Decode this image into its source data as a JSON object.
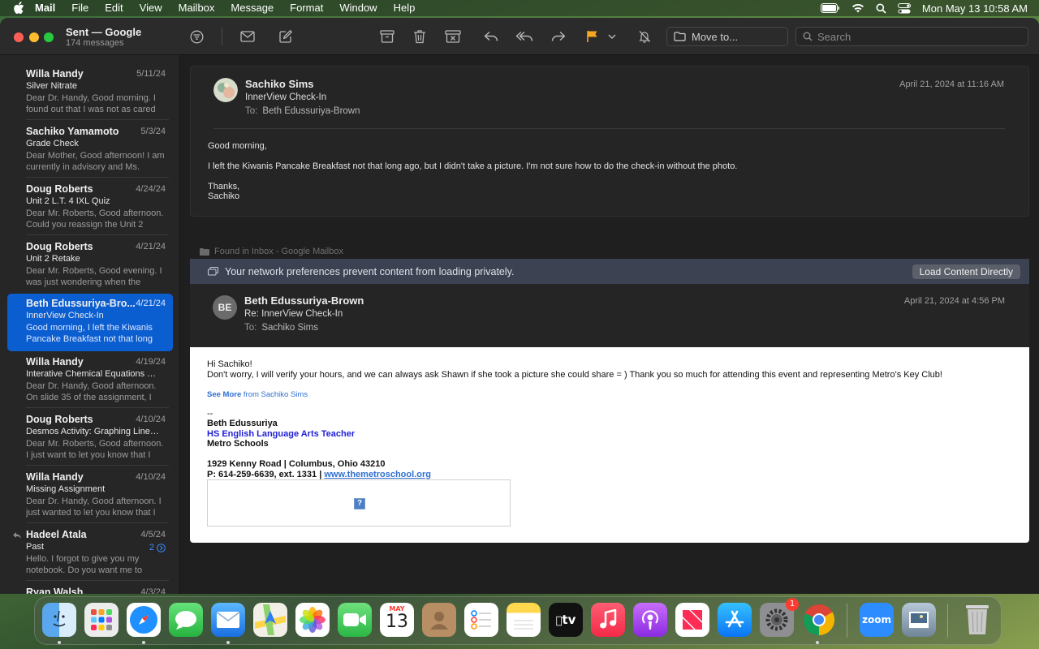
{
  "menubar": {
    "app_name": "Mail",
    "items": [
      "File",
      "Edit",
      "View",
      "Mailbox",
      "Message",
      "Format",
      "Window",
      "Help"
    ],
    "clock": "Mon May 13  10:58 AM",
    "icons": [
      "battery-icon",
      "wifi-icon",
      "spotlight-search-icon",
      "control-center-icon"
    ]
  },
  "toolbar": {
    "mailbox_title": "Sent — Google",
    "message_count": "174 messages",
    "move_to_label": "Move to...",
    "search_placeholder": "Search",
    "flag_color": "#f4a623",
    "buttons": [
      "filter",
      "get-mail",
      "compose",
      "archive",
      "delete",
      "junk",
      "reply",
      "reply-all",
      "forward",
      "flag",
      "flag-menu",
      "mute"
    ]
  },
  "messages": [
    {
      "sender": "Willa Handy",
      "date": "5/11/24",
      "subject": "Silver Nitrate",
      "preview": "Dear Dr. Handy, Good morning. I found out that I was not as cared a..."
    },
    {
      "sender": "Sachiko Yamamoto",
      "date": "5/3/24",
      "subject": "Grade Check",
      "preview": "Dear Mother, Good afternoon! I am currently in advisory and Ms. Bank..."
    },
    {
      "sender": "Doug Roberts",
      "date": "4/24/24",
      "subject": "Unit 2 L.T. 4 IXL Quiz",
      "preview": "Dear Mr. Roberts, Good afternoon. Could you reassign the Unit 2 L.T...."
    },
    {
      "sender": "Doug Roberts",
      "date": "4/21/24",
      "subject": "Unit 2 Retake",
      "preview": "Dear Mr. Roberts, Good evening. I was just wondering when the Unit..."
    },
    {
      "sender": "Beth Edussuriya-Bro...",
      "date": "4/21/24",
      "subject": "InnerView Check-In",
      "preview": "Good morning, I left the Kiwanis Pancake Breakfast not that long ag...",
      "selected": true
    },
    {
      "sender": "Willa Handy",
      "date": "4/19/24",
      "subject": "Interative Chemical Equations   Ty...",
      "preview": "Dear Dr. Handy, Good afternoon. On slide 35 of the assignment, I was c..."
    },
    {
      "sender": "Doug Roberts",
      "date": "4/10/24",
      "subject": "Desmos Activity: Graphing Linear...",
      "preview": "Dear Mr. Roberts, Good afternoon. I just want to let you know that I fini..."
    },
    {
      "sender": "Willa Handy",
      "date": "4/10/24",
      "subject": "Missing Assignment",
      "preview": "Dear Dr. Handy, Good afternoon. I just wanted to let you know that I j..."
    },
    {
      "sender": "Hadeel Atala",
      "date": "4/5/24",
      "subject": "Past",
      "preview": "Hello. I forgot to give you my notebook. Do you want me to take...",
      "thread_count": "2",
      "replied": true
    },
    {
      "sender": "Ryan Walsh",
      "date": "4/3/24",
      "subject": "",
      "preview": ""
    }
  ],
  "message1": {
    "from": "Sachiko Sims",
    "subject": "InnerView Check-In",
    "to_label": "To:",
    "to": "Beth Edussuriya-Brown",
    "date": "April 21, 2024 at 11:16 AM",
    "body": [
      "Good morning,",
      "I left the Kiwanis Pancake Breakfast not that long ago, but I didn't take a picture. I'm not sure how to do the check-in without the photo.",
      "Thanks,",
      "Sachiko"
    ]
  },
  "found_in": "Found in Inbox - Google Mailbox",
  "privacy_notice": {
    "text": "Your network preferences prevent content from loading privately.",
    "button": "Load Content Directly"
  },
  "message2": {
    "avatar_initials": "BE",
    "from": "Beth Edussuriya-Brown",
    "subject": "Re: InnerView Check-In",
    "to_label": "To:",
    "to": "Sachiko Sims",
    "date": "April 21, 2024 at 4:56 PM",
    "body": [
      "Hi Sachiko!",
      "Don't worry, I will verify your hours, and we can always ask Shawn if she took a picture she could share = ) Thank you so much for attending this event and representing Metro's Key Club!"
    ],
    "see_more": "See More",
    "see_more_from": "from Sachiko Sims",
    "signature": {
      "dash": "--",
      "name": "Beth Edussuriya",
      "title": "HS English Language Arts Teacher",
      "org": "Metro Schools",
      "address": "1929 Kenny Road | Columbus, Ohio 43210",
      "phone": "P: 614-259-6639, ext. 1331 | ",
      "website": "www.themetroschool.org"
    },
    "image_placeholder": "?"
  },
  "dock": {
    "apps": [
      "Finder",
      "Launchpad",
      "Safari",
      "Messages",
      "Mail",
      "Maps",
      "Photos",
      "FaceTime",
      "Calendar",
      "Contacts",
      "Reminders",
      "Notes",
      "TV",
      "Music",
      "Podcasts",
      "News",
      "App Store",
      "System Settings",
      "Chrome",
      "Zoom",
      "Preview",
      "Trash"
    ],
    "calendar_month": "MAY",
    "calendar_day": "13",
    "settings_badge": "1",
    "tv_label": "tv",
    "zoom_label": "zoom"
  }
}
